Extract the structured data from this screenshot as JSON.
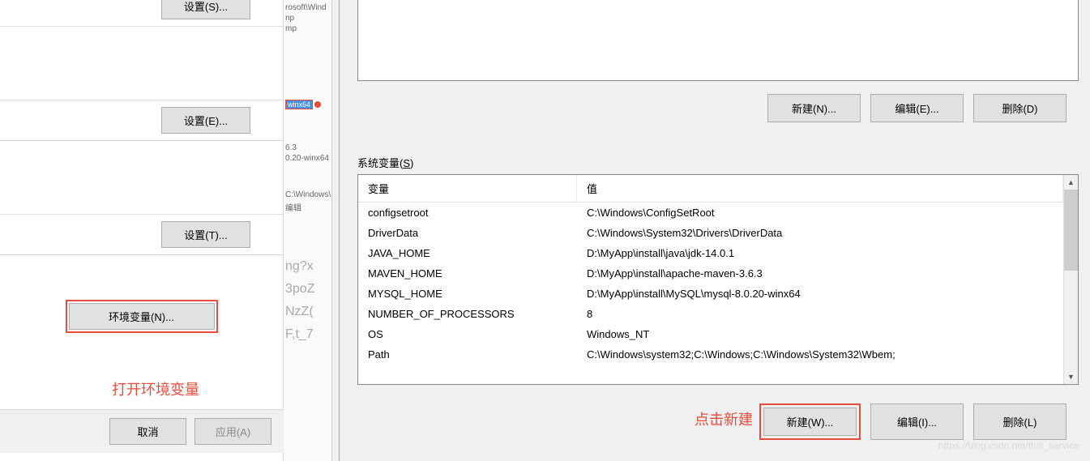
{
  "left": {
    "buttons": {
      "settings_s": "设置(S)...",
      "settings_e": "设置(E)...",
      "settings_t": "设置(T)...",
      "env": "环境变量(N)...",
      "cancel": "取消",
      "apply": "应用(A)"
    },
    "annotation": "打开环境变量"
  },
  "middle": {
    "lines": [
      "rosoft\\Wind",
      "np",
      "mp",
      "winx64",
      "6.3",
      "0.20-winx64",
      "C:\\Windows\\",
      "编辑",
      "ng?x",
      "3poZ",
      "NzZ(",
      "F,t_7"
    ]
  },
  "right": {
    "buttons": {
      "new_n": "新建(N)...",
      "edit_e": "编辑(E)...",
      "delete_d": "删除(D)",
      "new_w": "新建(W)...",
      "edit_i": "编辑(I)...",
      "delete_l": "删除(L)"
    },
    "sysvar_label_prefix": "系统变量(",
    "sysvar_label_u": "S",
    "sysvar_label_suffix": ")",
    "headers": {
      "name": "变量",
      "value": "值"
    },
    "rows": [
      {
        "name": "configsetroot",
        "value": "C:\\Windows\\ConfigSetRoot"
      },
      {
        "name": "DriverData",
        "value": "C:\\Windows\\System32\\Drivers\\DriverData"
      },
      {
        "name": "JAVA_HOME",
        "value": "D:\\MyApp\\install\\java\\jdk-14.0.1"
      },
      {
        "name": "MAVEN_HOME",
        "value": "D:\\MyApp\\install\\apache-maven-3.6.3"
      },
      {
        "name": "MYSQL_HOME",
        "value": "D:\\MyApp\\install\\MySQL\\mysql-8.0.20-winx64"
      },
      {
        "name": "NUMBER_OF_PROCESSORS",
        "value": "8"
      },
      {
        "name": "OS",
        "value": "Windows_NT"
      },
      {
        "name": "Path",
        "value": "C:\\Windows\\system32;C:\\Windows;C:\\Windows\\System32\\Wbem;"
      }
    ],
    "annotation": "点击新建",
    "watermark": "https://blog.csdn.net/this_service"
  }
}
